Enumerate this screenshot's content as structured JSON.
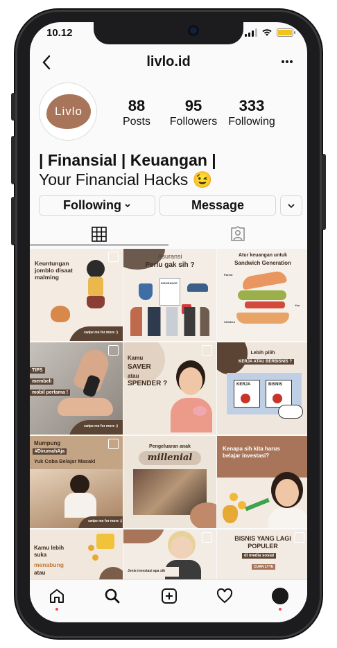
{
  "status_bar": {
    "time": "10.12"
  },
  "header": {
    "back_icon": "chevron-left-icon",
    "username": "livlo.id",
    "more_icon": "more-dots-icon"
  },
  "profile": {
    "avatar_text": "Livlo",
    "avatar_color": "#a8755a",
    "stats": [
      {
        "value": "88",
        "label": "Posts"
      },
      {
        "value": "95",
        "label": "Followers"
      },
      {
        "value": "333",
        "label": "Following"
      }
    ],
    "bio_line1": "| Finansial | Keuangan |",
    "bio_line2": "Your Financial Hacks 😉"
  },
  "actions": {
    "following_label": "Following",
    "message_label": "Message"
  },
  "tabs": [
    {
      "icon": "grid-icon"
    },
    {
      "icon": "tagged-person-icon"
    }
  ],
  "posts": [
    {
      "title": "Keuntungan jomblo disaat malming",
      "caption": "swipe me for more :)"
    },
    {
      "title": "Asuransi",
      "subtitle": "Perlu gak sih ?",
      "doc_label": "INSURANCE"
    },
    {
      "title": "Atur keuangan untuk",
      "subtitle": "Sandwich Generation",
      "labels": [
        "Parent",
        "You",
        "Children"
      ]
    },
    {
      "title": "TIPS",
      "line2": "membeli",
      "line3": "mobil pertama !",
      "caption": "swipe me for more :)"
    },
    {
      "title": "Kamu",
      "line2": "SAVER",
      "line3": "atau",
      "line4": "SPENDER ?"
    },
    {
      "title": "Lebih pilih",
      "subtitle": "KERJA ATAU BERBISNIS ?",
      "btn1": "KERJA",
      "btn2": "BISNIS"
    },
    {
      "title": "Mumpung",
      "line2": "#DirumahAja",
      "line3": "Yuk Coba Belajar Masak!",
      "caption": "swipe me for more :)"
    },
    {
      "title": "Pengeluaran anak",
      "subtitle": "millenial"
    },
    {
      "title": "Kenapa sih kita harus belajar investasi?"
    },
    {
      "title": "Kamu lebih suka",
      "line2": "menabung",
      "line3": "atau"
    },
    {
      "title": "Jenis investasi apa sih"
    },
    {
      "title": "BISNIS YANG LAGI POPULER",
      "subtitle": "di media sosial",
      "badge": "CUAN LYTE"
    }
  ],
  "nav": [
    {
      "icon": "home-icon"
    },
    {
      "icon": "search-icon"
    },
    {
      "icon": "new-post-icon"
    },
    {
      "icon": "heart-icon"
    },
    {
      "icon": "profile-avatar-icon"
    }
  ]
}
